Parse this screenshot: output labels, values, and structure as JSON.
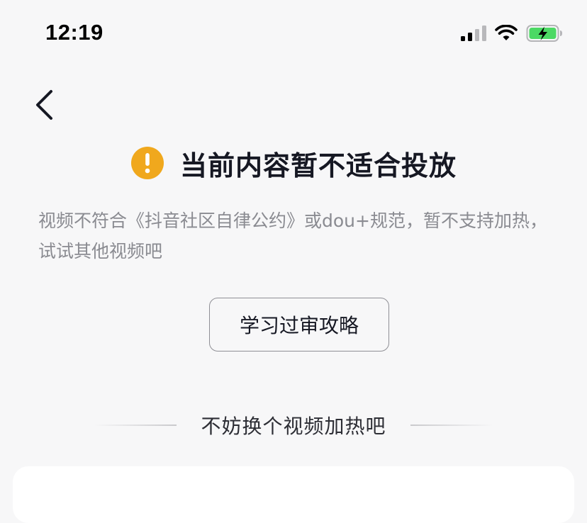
{
  "status_bar": {
    "time": "12:19",
    "icons": [
      "cellular-signal-icon",
      "wifi-icon",
      "battery-charging-icon"
    ],
    "battery_color": "#4cd964"
  },
  "nav": {
    "back_icon": "chevron-left-icon"
  },
  "notice": {
    "icon": "warning-exclamation-icon",
    "icon_color": "#f0a81d",
    "title": "当前内容暂不适合投放",
    "description": "视频不符合《抖音社区自律公约》或dou+规范，暂不支持加热，试试其他视频吧"
  },
  "guide_button_label": "学习过审攻略",
  "section": {
    "title": "不妨换个视频加热吧"
  }
}
